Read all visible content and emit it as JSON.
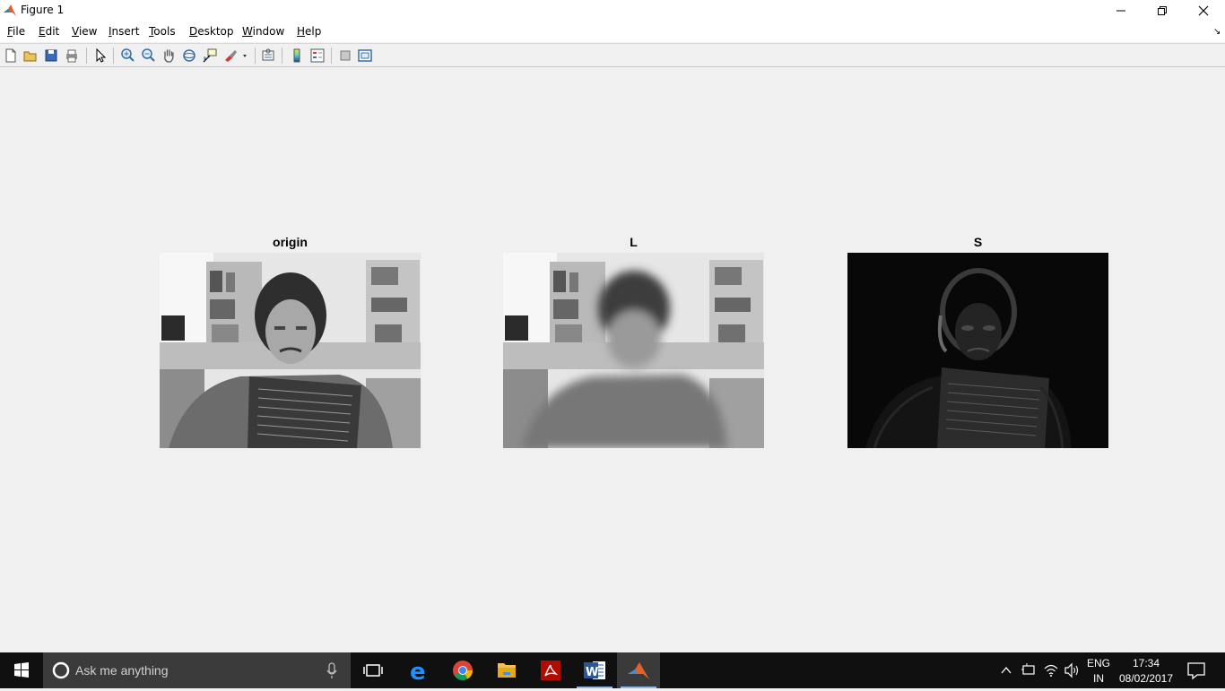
{
  "window": {
    "title": "Figure 1"
  },
  "menu": [
    "File",
    "Edit",
    "View",
    "Insert",
    "Tools",
    "Desktop",
    "Window",
    "Help"
  ],
  "toolbar": {
    "buttons": [
      "new-figure-icon",
      "open-file-icon",
      "save-icon",
      "print-icon",
      "edit-plot-arrow-icon",
      "zoom-in-icon",
      "zoom-out-icon",
      "pan-hand-icon",
      "rotate-3d-icon",
      "data-cursor-icon",
      "brush-icon",
      "link-plot-icon",
      "colorbar-icon",
      "legend-icon",
      "hide-plot-tools-icon",
      "show-plot-tools-icon"
    ]
  },
  "figure": {
    "panels": [
      {
        "title": "origin"
      },
      {
        "title": "L"
      },
      {
        "title": "S"
      }
    ]
  },
  "taskbar": {
    "search_placeholder": "Ask me anything",
    "apps": [
      "task-view-icon",
      "edge-icon",
      "chrome-icon",
      "file-explorer-icon",
      "acrobat-icon",
      "word-icon",
      "matlab-icon"
    ],
    "language_top": "ENG",
    "language_bottom": "IN",
    "time": "17:34",
    "date": "08/02/2017"
  },
  "colors": {
    "accent": "#8fb8e8",
    "taskbar": "#101010"
  }
}
